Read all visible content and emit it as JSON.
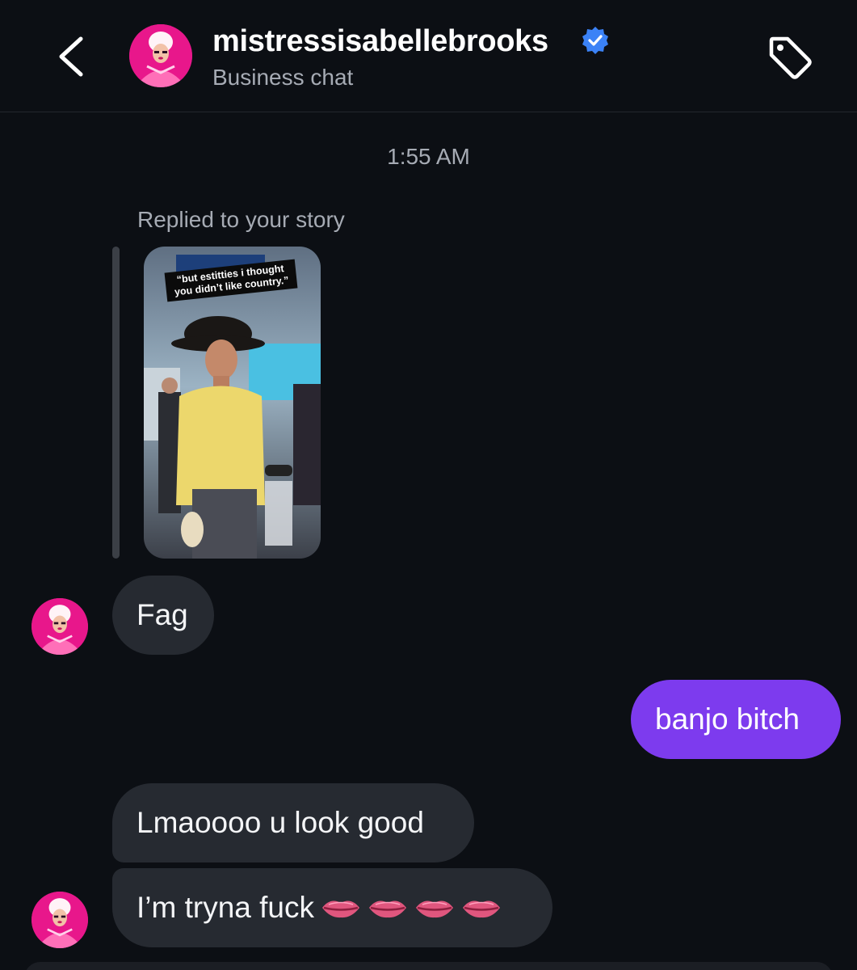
{
  "header": {
    "username": "mistressisabellebrooks",
    "subtitle": "Business chat",
    "verified": true,
    "icons": {
      "back": "chevron-left-icon",
      "verified": "verified-badge-icon",
      "tag": "tag-icon"
    }
  },
  "chat": {
    "timestamp": "1:55 AM",
    "reply_label": "Replied to your story",
    "story_caption": "“but estitties i thought you didn’t like country.”",
    "messages": [
      {
        "side": "incoming",
        "text": "Fag"
      },
      {
        "side": "outgoing",
        "text": "banjo bitch"
      },
      {
        "side": "incoming",
        "text": "Lmaoooo u look good"
      },
      {
        "side": "incoming",
        "text": "I’m tryna fuck",
        "emoji": [
          "lips",
          "lips",
          "lips",
          "lips"
        ]
      }
    ]
  },
  "colors": {
    "background": "#0c0f14",
    "incoming_bubble": "#262a31",
    "outgoing_bubble": "#7d3bee",
    "muted_text": "#a6abb4",
    "verified_blue": "#3b82f6"
  }
}
